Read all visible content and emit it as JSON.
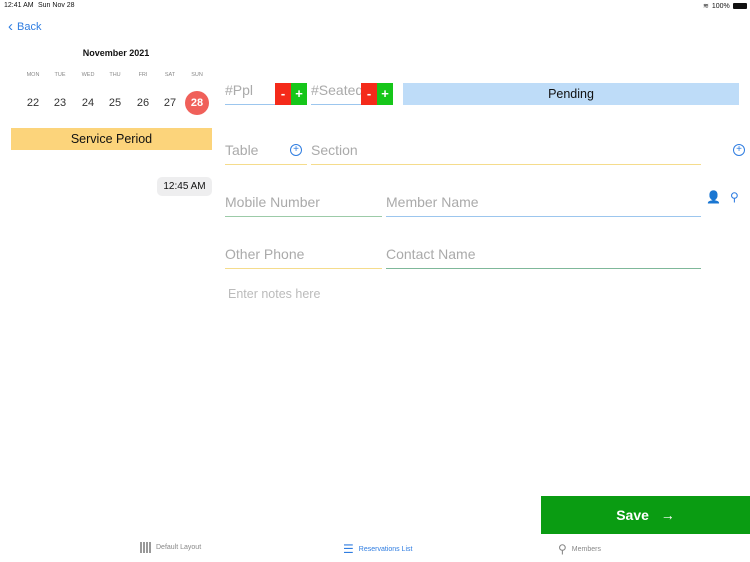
{
  "status": {
    "time": "12:41 AM",
    "date": "Sun Nov 28",
    "battery": "100%"
  },
  "nav": {
    "back": "Back"
  },
  "calendar": {
    "month": "November 2021",
    "weekdays": [
      "MON",
      "TUE",
      "WED",
      "THU",
      "FRI",
      "SAT",
      "SUN"
    ],
    "days": [
      "22",
      "23",
      "24",
      "25",
      "26",
      "27",
      "28"
    ],
    "selected_index": 6
  },
  "service_period": "Service Period",
  "time": "12:45 AM",
  "form": {
    "ppl": "#Ppl",
    "seated": "#Seated",
    "minus": "-",
    "plus": "+",
    "status": "Pending",
    "table": "Table",
    "section": "Section",
    "mobile": "Mobile Number",
    "member_name": "Member Name",
    "other_phone": "Other Phone",
    "contact_name": "Contact Name",
    "notes_placeholder": "Enter notes here"
  },
  "save": {
    "label": "Save",
    "arrow": "→"
  },
  "tabs": [
    {
      "label": "Default Layout",
      "icon": "grid-icon"
    },
    {
      "label": "Reservations List",
      "icon": "list-icon",
      "active": true
    },
    {
      "label": "Members",
      "icon": "member-search-icon"
    }
  ],
  "colors": {
    "accent": "#2f7de1",
    "save": "#0a9c12",
    "selected_day": "#f0605a",
    "service": "#fcd47b",
    "pending": "#bedcf8"
  }
}
